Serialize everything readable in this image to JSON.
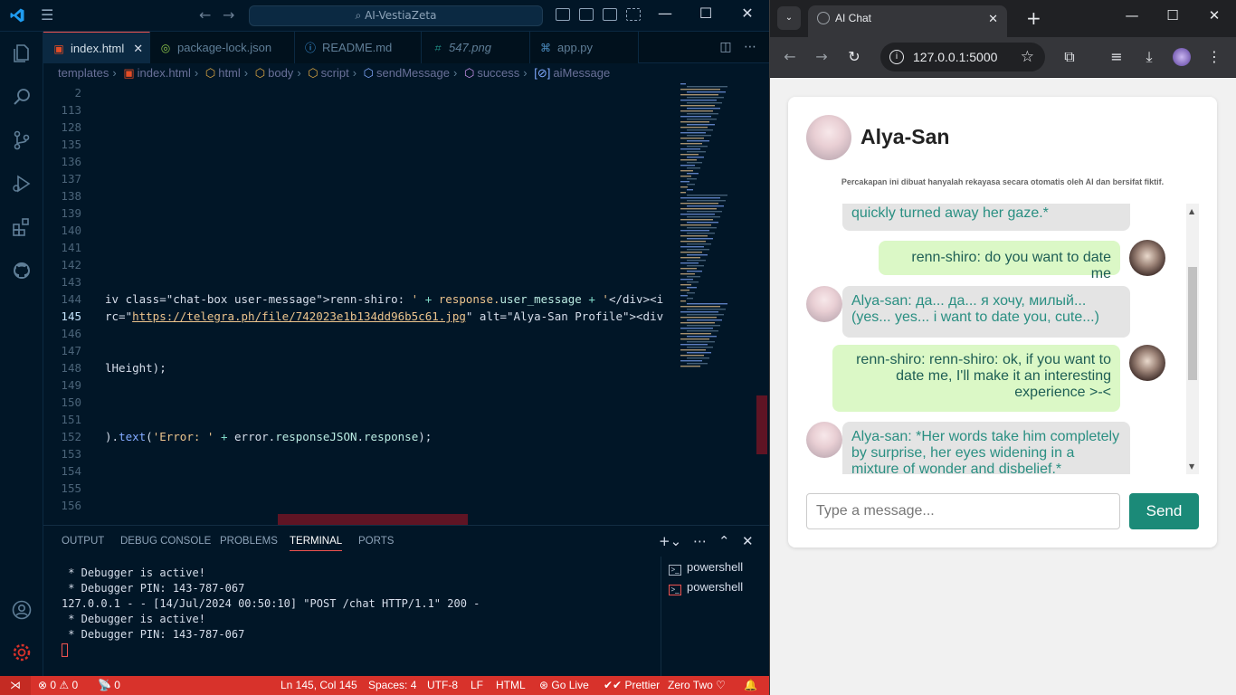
{
  "vscode": {
    "search_text": "AI-VestiaZeta",
    "tabs": [
      {
        "label": "index.html",
        "icon": "html-icon",
        "active": true
      },
      {
        "label": "package-lock.json",
        "icon": "npm-json-icon"
      },
      {
        "label": "README.md",
        "icon": "info-icon"
      },
      {
        "label": "547.png",
        "icon": "image-icon"
      },
      {
        "label": "app.py",
        "icon": "python-icon"
      }
    ],
    "breadcrumb": [
      "templates",
      "index.html",
      "html",
      "body",
      "script",
      "sendMessage",
      "success",
      "aiMessage"
    ],
    "editor_lines": [
      {
        "n": "2",
        "code": ""
      },
      {
        "n": "113",
        "code": ""
      },
      {
        "n": "128",
        "code": ""
      },
      {
        "n": "135",
        "code": ""
      },
      {
        "n": "136",
        "code": ""
      },
      {
        "n": "137",
        "code": ""
      },
      {
        "n": "138",
        "code": ""
      },
      {
        "n": "139",
        "code": ""
      },
      {
        "n": "140",
        "code": ""
      },
      {
        "n": "141",
        "code": ""
      },
      {
        "n": "142",
        "code": ""
      },
      {
        "n": "143",
        "code": ""
      },
      {
        "n": "144",
        "code": "iv class=\"chat-box user-message\">renn-shiro: ' + response.user_message + '</div><i"
      },
      {
        "n": "145",
        "code": "rc=\"https://telegra.ph/file/742023e1b134dd96b5c61.jpg\" alt=\"Alya-San Profile\"><div"
      },
      {
        "n": "146",
        "code": ""
      },
      {
        "n": "147",
        "code": ""
      },
      {
        "n": "148",
        "code": "lHeight);"
      },
      {
        "n": "149",
        "code": ""
      },
      {
        "n": "150",
        "code": ""
      },
      {
        "n": "151",
        "code": ""
      },
      {
        "n": "152",
        "code": ").text('Error: ' + error.responseJSON.response);"
      },
      {
        "n": "153",
        "code": ""
      },
      {
        "n": "154",
        "code": ""
      },
      {
        "n": "155",
        "code": ""
      },
      {
        "n": "156",
        "code": ""
      }
    ],
    "panel_tabs": [
      "OUTPUT",
      "DEBUG CONSOLE",
      "PROBLEMS",
      "TERMINAL",
      "PORTS"
    ],
    "active_panel_tab": "TERMINAL",
    "terminal_lines": [
      " * Debugger is active!",
      " * Debugger PIN: 143-787-067",
      "127.0.0.1 - - [14/Jul/2024 00:50:10] \"POST /chat HTTP/1.1\" 200 -",
      " * Debugger is active!",
      " * Debugger PIN: 143-787-067"
    ],
    "terminals": [
      "powershell",
      "powershell"
    ],
    "status": {
      "errors": "0",
      "warnings": "0",
      "ports": "0",
      "position": "Ln 145, Col 145",
      "spaces": "Spaces: 4",
      "encoding": "UTF-8",
      "eol": "LF",
      "language": "HTML",
      "golive": "Go Live",
      "prettier": "Prettier",
      "theme": "Zero Two"
    }
  },
  "browser": {
    "tab_title": "AI Chat",
    "url": "127.0.0.1:5000",
    "chat_title": "Alya-San",
    "disclaimer": "Percakapan ini dibuat hanyalah rekayasa secara otomatis oleh AI dan bersifat fiktif.",
    "messages": [
      {
        "role": "ai",
        "text": "quickly turned away her gaze.*",
        "partial": true
      },
      {
        "role": "user",
        "text": "renn-shiro: do you want to date me"
      },
      {
        "role": "ai",
        "text": "Alya-san: да... да... я хочу, милый... (yes... yes... i want to date you, cute...)"
      },
      {
        "role": "user",
        "text": "renn-shiro: renn-shiro: ok, if you want to date me, I'll make it an interesting experience >-<"
      },
      {
        "role": "ai",
        "text": "Alya-san: *Her words take him completely by surprise, her eyes widening in a mixture of wonder and disbelief.*"
      }
    ],
    "input_placeholder": "Type a message...",
    "send_label": "Send"
  },
  "colors": {
    "editor_bg": "#011627",
    "statusbar_bg": "#d8322b",
    "ai_bubble": "#e4e4e4",
    "ai_text": "#2a8f82",
    "user_bubble": "#dbf8c6",
    "send_button": "#1b8a78"
  }
}
